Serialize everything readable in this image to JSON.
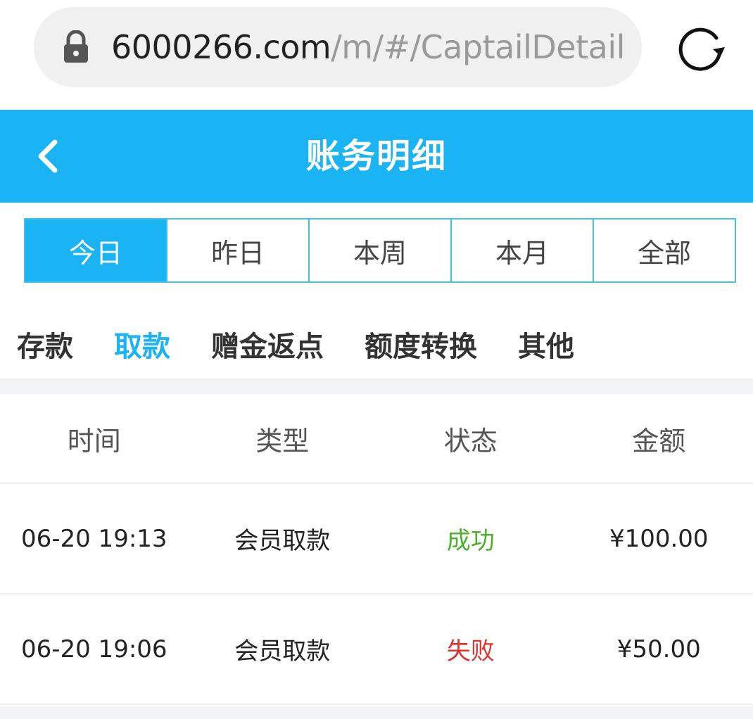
{
  "browser": {
    "url_host": "6000266.com",
    "url_path": "/m/#/CaptailDetail"
  },
  "header": {
    "title": "账务明细"
  },
  "date_tabs": [
    {
      "label": "今日",
      "active": true
    },
    {
      "label": "昨日",
      "active": false
    },
    {
      "label": "本周",
      "active": false
    },
    {
      "label": "本月",
      "active": false
    },
    {
      "label": "全部",
      "active": false
    }
  ],
  "category_tabs": [
    {
      "label": "存款",
      "active": false
    },
    {
      "label": "取款",
      "active": true
    },
    {
      "label": "赠金返点",
      "active": false
    },
    {
      "label": "额度转换",
      "active": false
    },
    {
      "label": "其他",
      "active": false
    }
  ],
  "table": {
    "columns": [
      "时间",
      "类型",
      "状态",
      "金额"
    ],
    "rows": [
      {
        "time": "06-20 19:13",
        "type": "会员取款",
        "status": "成功",
        "amount": "¥100.00"
      },
      {
        "time": "06-20 19:06",
        "type": "会员取款",
        "status": "失败",
        "amount": "¥50.00"
      }
    ]
  },
  "colors": {
    "accent": "#1ab3f4",
    "success": "#4cb02c",
    "fail": "#e0322c"
  },
  "icons": {
    "lock": "lock-icon",
    "reload": "reload-icon",
    "back": "chevron-left-icon"
  }
}
